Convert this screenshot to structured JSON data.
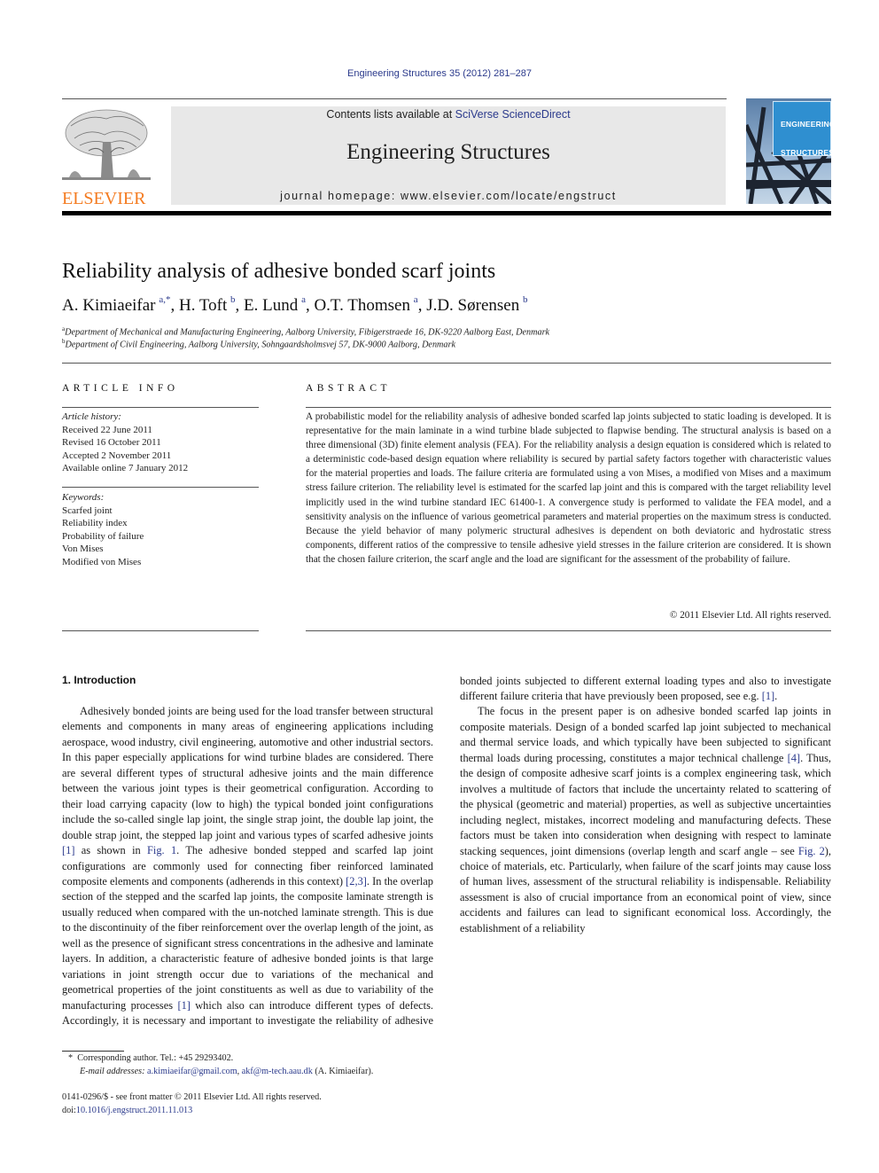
{
  "citation": "Engineering Structures 35 (2012) 281–287",
  "banner": {
    "contents_prefix": "Contents lists available at ",
    "contents_link": "SciVerse ScienceDirect",
    "journal_name": "Engineering Structures",
    "homepage_prefix": "journal homepage: ",
    "homepage_url": "www.elsevier.com/locate/engstruct"
  },
  "publisher_logo": {
    "word": "ELSEVIER",
    "color": "#f47b20"
  },
  "cover": {
    "line1": "ENGINEERING",
    "line2": "STRUCTURES"
  },
  "article": {
    "title": "Reliability analysis of adhesive bonded scarf joints",
    "authors": [
      {
        "name": "A. Kimiaeifar",
        "aff": "a,*"
      },
      {
        "name": "H. Toft",
        "aff": "b"
      },
      {
        "name": "E. Lund",
        "aff": "a"
      },
      {
        "name": "O.T. Thomsen",
        "aff": "a"
      },
      {
        "name": "J.D. Sørensen",
        "aff": "b"
      }
    ],
    "affiliations": [
      {
        "mark": "a",
        "text": "Department of Mechanical and Manufacturing Engineering, Aalborg University, Fibigerstraede 16, DK-9220 Aalborg East, Denmark"
      },
      {
        "mark": "b",
        "text": "Department of Civil Engineering, Aalborg University, Sohngaardsholmsvej 57, DK-9000 Aalborg, Denmark"
      }
    ]
  },
  "article_info": {
    "heading": "ARTICLE INFO",
    "history_label": "Article history:",
    "history": [
      "Received 22 June 2011",
      "Revised 16 October 2011",
      "Accepted 2 November 2011",
      "Available online 7 January 2012"
    ],
    "keywords_label": "Keywords:",
    "keywords": [
      "Scarfed joint",
      "Reliability index",
      "Probability of failure",
      "Von Mises",
      "Modified von Mises"
    ]
  },
  "abstract": {
    "heading": "ABSTRACT",
    "text": "A probabilistic model for the reliability analysis of adhesive bonded scarfed lap joints subjected to static loading is developed. It is representative for the main laminate in a wind turbine blade subjected to flapwise bending. The structural analysis is based on a three dimensional (3D) finite element analysis (FEA). For the reliability analysis a design equation is considered which is related to a deterministic code-based design equation where reliability is secured by partial safety factors together with characteristic values for the material properties and loads. The failure criteria are formulated using a von Mises, a modified von Mises and a maximum stress failure criterion. The reliability level is estimated for the scarfed lap joint and this is compared with the target reliability level implicitly used in the wind turbine standard IEC 61400-1. A convergence study is performed to validate the FEA model, and a sensitivity analysis on the influence of various geometrical parameters and material properties on the maximum stress is conducted. Because the yield behavior of many polymeric structural adhesives is dependent on both deviatoric and hydrostatic stress components, different ratios of the compressive to tensile adhesive yield stresses in the failure criterion are considered. It is shown that the chosen failure criterion, the scarf angle and the load are significant for the assessment of the probability of failure.",
    "copyright": "© 2011 Elsevier Ltd. All rights reserved."
  },
  "intro": {
    "heading": "1. Introduction",
    "p1": [
      {
        "t": "Adhesively bonded joints are being used for the load transfer between structural elements and components in many areas of engineering applications including aerospace, wood industry, civil engineering, automotive and other industrial sectors. In this paper especially applications for wind turbine blades are considered. There are several different types of structural adhesive joints and the main difference between the various joint types is their geometrical configuration. According to their load carrying capacity (low to high) the typical bonded joint configurations include the so-called single lap joint, the single strap joint, the double lap joint, the double strap joint, the stepped lap joint and various types of scarfed adhesive joints "
      },
      {
        "t": "[1]",
        "link": true
      },
      {
        "t": " as shown in "
      },
      {
        "t": "Fig. 1",
        "link": true
      },
      {
        "t": ". The adhesive bonded stepped and scarfed lap joint configurations are commonly used for connecting fiber reinforced laminated composite elements and components (adherends in this context) "
      },
      {
        "t": "[2,3]",
        "link": true
      },
      {
        "t": ". In the overlap section of the stepped and the scarfed lap joints, the composite laminate strength is usually reduced when compared with the un-notched laminate strength. This is due to the discontinuity of the fiber reinforcement over the overlap length of the joint, as well as the presence of significant stress concentrations in the adhesive and laminate layers. In addition, a characteristic feature of adhesive bonded joints is that large variations in joint strength occur due to variations of the mechanical and geometrical properties of the joint constituents as well as due to variability of the manufacturing processes "
      },
      {
        "t": "[1]",
        "link": true
      },
      {
        "t": " which also can introduce different types of defects. Accordingly, it is necessary and important to investigate the reliability of adhesive bonded joints subjected to different external loading types and also to investigate different failure criteria that have previously been proposed, see e.g. "
      },
      {
        "t": "[1]",
        "link": true
      },
      {
        "t": "."
      }
    ],
    "p2": [
      {
        "t": "The focus in the present paper is on adhesive bonded scarfed lap joints in composite materials. Design of a bonded scarfed lap joint subjected to mechanical and thermal service loads, and which typically have been subjected to significant thermal loads during processing, constitutes a major technical challenge "
      },
      {
        "t": "[4]",
        "link": true
      },
      {
        "t": ". Thus, the design of composite adhesive scarf joints is a complex engineering task, which involves a multitude of factors that include the uncertainty related to scattering of the physical (geometric and material) properties, as well as subjective uncertainties including neglect, mistakes, incorrect modeling and manufacturing defects. These factors must be taken into consideration when designing with respect to laminate stacking sequences, joint dimensions (overlap length and scarf angle – see "
      },
      {
        "t": "Fig. 2",
        "link": true
      },
      {
        "t": "), choice of materials, etc. Particularly, when failure of the scarf joints may cause loss of human lives, assessment of the structural reliability is indispensable. Reliability assessment is also of crucial importance from an economical point of view, since accidents and failures can lead to significant economical loss. Accordingly, the establishment of a reliability"
      }
    ],
    "col1_split": 11
  },
  "footnote": {
    "mark": "*",
    "corresponding": "Corresponding author. Tel.: +45 29293402.",
    "email_label": "E-mail addresses:",
    "emails": [
      "a.kimiaeifar@gmail.com",
      "akf@m-tech.aau.dk"
    ],
    "email_suffix": "(A. Kimiaeifar)."
  },
  "front_matter": {
    "issn_line": "0141-0296/$ - see front matter © 2011 Elsevier Ltd. All rights reserved.",
    "doi_label": "doi:",
    "doi": "10.1016/j.engstruct.2011.11.013"
  },
  "colors": {
    "link": "#2b3a8c",
    "banner_bg": "#e8e8e8",
    "elsevier_orange": "#f47b20"
  }
}
